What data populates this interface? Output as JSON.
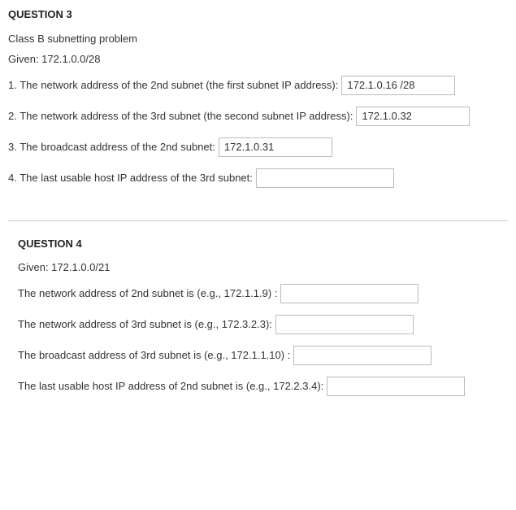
{
  "q3": {
    "title": "QUESTION 3",
    "stem1": "Class B subnetting problem",
    "stem2": "Given: 172.1.0.0/28",
    "rows": [
      {
        "label": "1. The network address of the 2nd subnet (the first subnet IP address):",
        "value": "172.1.0.16 /28"
      },
      {
        "label": "2. The network address of the 3rd subnet (the second subnet IP address):",
        "value": "172.1.0.32"
      },
      {
        "label": "3. The broadcast address of the 2nd subnet:",
        "value": "172.1.0.31"
      },
      {
        "label": "4. The last usable host IP address of the 3rd subnet:",
        "value": ""
      }
    ]
  },
  "q4": {
    "title": "QUESTION 4",
    "stem": "Given: 172.1.0.0/21",
    "rows": [
      {
        "label": "The network address of 2nd subnet is (e.g., 172.1.1.9) :",
        "value": ""
      },
      {
        "label": "The network address of 3rd subnet is (e.g., 172.3.2.3):",
        "value": ""
      },
      {
        "label": "The broadcast address of 3rd subnet is (e.g., 172.1.1.10) :",
        "value": ""
      },
      {
        "label": "The last usable host IP address of 2nd subnet is (e.g., 172.2.3.4):",
        "value": ""
      }
    ]
  }
}
